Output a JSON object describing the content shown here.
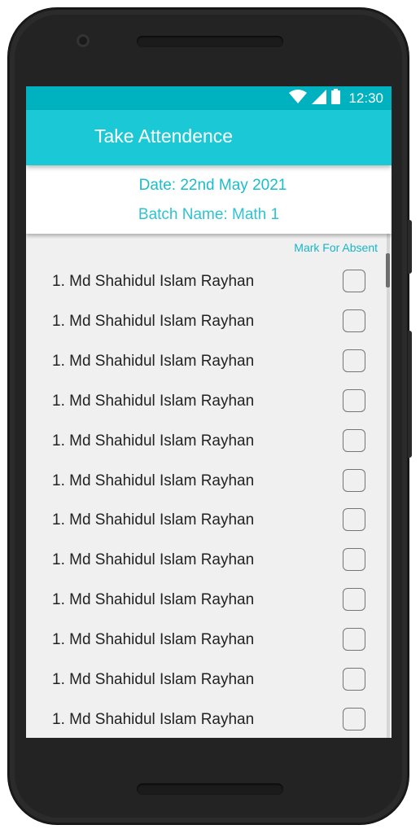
{
  "status_bar": {
    "time": "12:30",
    "icons": [
      "wifi-icon",
      "signal-icon",
      "battery-icon"
    ]
  },
  "app_bar": {
    "title": "Take Attendence"
  },
  "info": {
    "date": "Date: 22nd May 2021",
    "batch": "Batch Name: Math 1"
  },
  "list": {
    "header": "Mark For Absent",
    "students": [
      {
        "label": "1. Md Shahidul Islam Rayhan",
        "checked": false
      },
      {
        "label": "1. Md Shahidul Islam Rayhan",
        "checked": false
      },
      {
        "label": "1. Md Shahidul Islam Rayhan",
        "checked": false
      },
      {
        "label": "1. Md Shahidul Islam Rayhan",
        "checked": false
      },
      {
        "label": "1. Md Shahidul Islam Rayhan",
        "checked": false
      },
      {
        "label": "1. Md Shahidul Islam Rayhan",
        "checked": false
      },
      {
        "label": "1. Md Shahidul Islam Rayhan",
        "checked": false
      },
      {
        "label": "1. Md Shahidul Islam Rayhan",
        "checked": false
      },
      {
        "label": "1. Md Shahidul Islam Rayhan",
        "checked": false
      },
      {
        "label": "1. Md Shahidul Islam Rayhan",
        "checked": false
      },
      {
        "label": "1. Md Shahidul Islam Rayhan",
        "checked": false
      },
      {
        "label": "1. Md Shahidul Islam Rayhan",
        "checked": false
      }
    ]
  },
  "colors": {
    "status_bar": "#00b2bf",
    "app_bar": "#1bc8d6",
    "accent_text": "#1bbccb",
    "background": "#f0f0f0"
  }
}
